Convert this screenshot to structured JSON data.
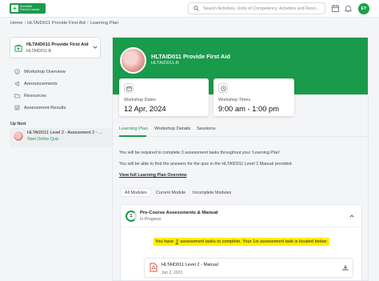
{
  "logo": {
    "line1": "Accredited",
    "line2": "First Aid Courses"
  },
  "search": {
    "placeholder": "Search Activities, Units of Competency, Activities and Reso..."
  },
  "user": {
    "initials": "EY"
  },
  "breadcrumb": [
    "Home",
    "HLTAID011 Provide First Aid",
    "Learning Plan"
  ],
  "sidebar": {
    "course_title": "HLTAID011 Provide First Aid",
    "course_code": "HLTAID011-B",
    "items": [
      {
        "label": "Workshop Overview",
        "icon": "info-icon"
      },
      {
        "label": "Announcements",
        "icon": "megaphone-icon"
      },
      {
        "label": "Resources",
        "icon": "folder-icon"
      },
      {
        "label": "Assessment Results",
        "icon": "checklist-icon"
      }
    ],
    "up_next_label": "Up Next",
    "up_next_title": "HLTAID011 Level 2 - Assessment 2 - ...",
    "up_next_action": "Start Online Quiz"
  },
  "hero": {
    "title": "HLTAID011 Provide First Aid",
    "code": "HLTAID011-B"
  },
  "workshop_dates": {
    "label": "Workshop Dates",
    "value": "12 Apr, 2024"
  },
  "workshop_times": {
    "label": "Workshop Times",
    "value": "9:00 am - 1:00 pm"
  },
  "tabs": [
    "Learning Plan",
    "Workshop Details",
    "Sessions"
  ],
  "content": {
    "line1": "You will be required to complete 3 assessment tasks throughout your 'Learning Plan'",
    "line2": "You will be able to find the answers for the quiz in the HLTAID011 Level 2 Manual provided.",
    "link": "View full Learning Plan Overview"
  },
  "filters": [
    "All Modules",
    "Current Module",
    "Incomplete Modules"
  ],
  "module": {
    "number": "1",
    "title": "Pre-Course Assessments & Manual",
    "status": "In Progress",
    "notice_pre": "You have",
    "notice_count": "3",
    "notice_post": "assessment tasks to complete. Your 1st assessment task is located below:",
    "file_name": "HLTAID011 Level 2 - Manual",
    "file_date": "Jun 2, 2023"
  },
  "colors": {
    "brand": "#1a9a4b",
    "highlight": "#ffee00",
    "pdf": "#e5533d"
  }
}
